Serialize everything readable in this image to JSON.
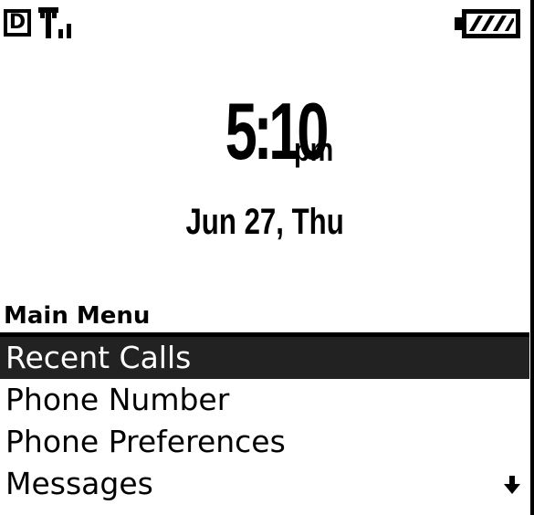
{
  "status_bar": {
    "mode_badge": "D",
    "signal_icon": "signal-strength-icon",
    "battery_icon": "battery-full-icon"
  },
  "clock": {
    "time": "5:10",
    "ampm": "pm",
    "date": "Jun 27, Thu"
  },
  "menu": {
    "title": "Main Menu",
    "selected_index": 0,
    "items": [
      {
        "label": "Recent Calls"
      },
      {
        "label": "Phone Number"
      },
      {
        "label": "Phone Preferences"
      },
      {
        "label": "Messages"
      }
    ],
    "more_indicator_icon": "scroll-down-arrow-icon"
  },
  "colors": {
    "background": "#ffffff",
    "foreground": "#000000",
    "selection": "#222222"
  }
}
